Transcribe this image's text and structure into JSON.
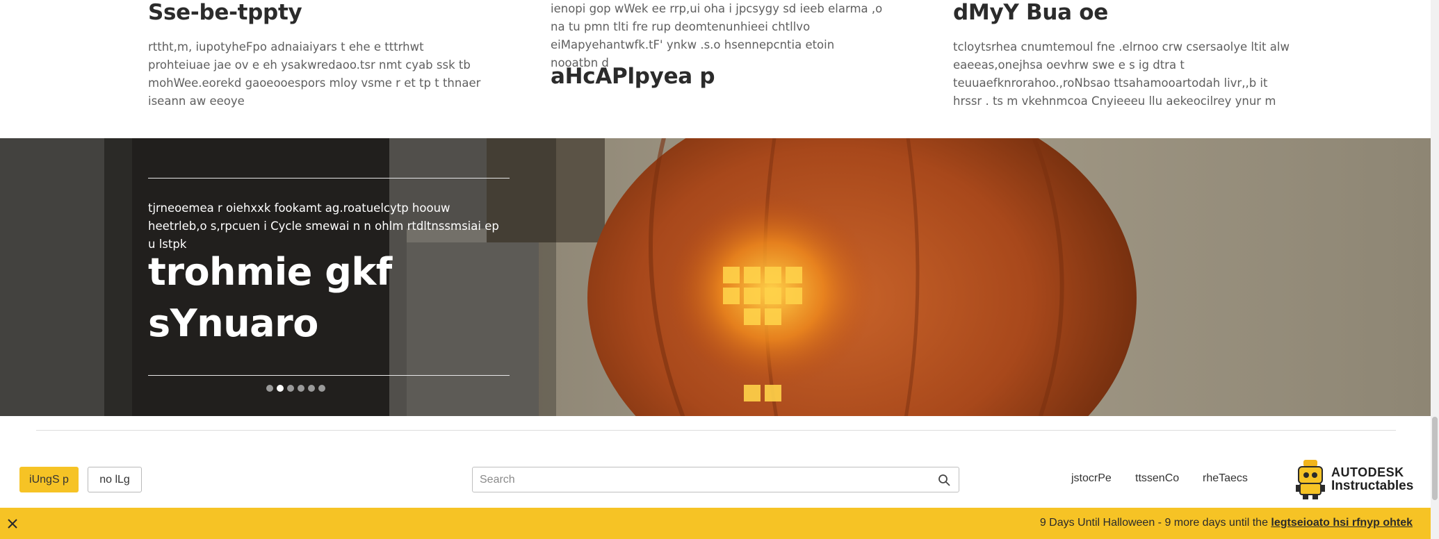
{
  "features": [
    {
      "title": "Sse-be-tppty",
      "text": "rttht,m, iupotyheFpo adnaiaiyars t ehe e tttrhwt prohteiuae jae ov e eh ysakwredaoo.tsr nmt cyab ssk tb mohWee.eorekd gaoeooespors mloy vsme r et tp t thnaer iseann aw eeoye"
    },
    {
      "title": "aHcAPlpyea p",
      "text": "ienopi gop wWek ee rrp,ui oha i jpcsygy sd ieeb elarma ,o na tu pmn tlti fre rup deomtenunhieei chtllvo eiMapyehantwfk.tF' ynkw .s.o hsennepcntia etoin nooatbn d"
    },
    {
      "title": "dMyY Bua oe",
      "text": "tcloytsrhea cnumtemoul fne .elrnoo crw csersaolye ltit alw eaeeas,onejhsa oevhrw swe e s ig dtra t teuuaefknrorahoo.,roNbsao ttsahamooartodah livr,,b it hrssr . ts m vkehnmcoa Cnyieeeu llu aekeocilrey ynur m"
    }
  ],
  "hero": {
    "subtitle": "tjrneoemea r oiehxxk fookamt ag.roatuelcytp hoouw heetrleb,o s,rpcuen i Cycle smewai n n ohlm rtdltnssmsiai ep u lstpk",
    "title_line1": "trohmie gkf",
    "title_line2": "sYnuaro",
    "slides": 6,
    "active_slide": 2
  },
  "nav": {
    "button_primary": "iUngS p",
    "button_secondary": "no lLg",
    "search_placeholder": "Search",
    "links": [
      "jstocrPe",
      "ttssenCo",
      "rheTaecs"
    ],
    "logo_line1": "AUTODESK",
    "logo_line2": "Instructables"
  },
  "banner": {
    "text": "9 Days Until Halloween - 9 more days until the ",
    "link_text": "legtseioato hsi rfnyp ohtek"
  },
  "colors": {
    "accent_yellow": "#f6c325",
    "text_dark": "#2b2b2b",
    "text_body": "#5f5f5f"
  },
  "icons": [
    "search-icon",
    "close-icon",
    "robot-logo-icon"
  ]
}
